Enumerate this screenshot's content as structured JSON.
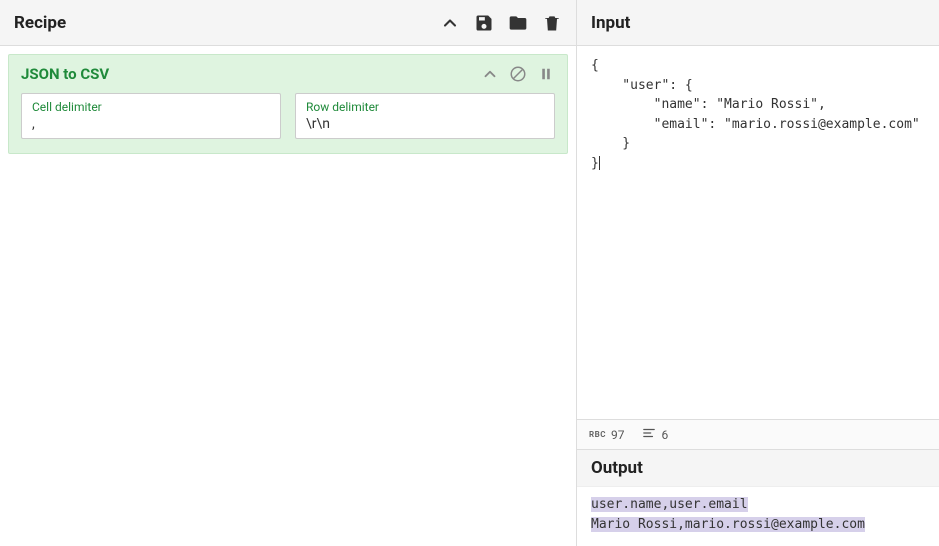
{
  "recipe": {
    "title": "Recipe",
    "operation": {
      "title": "JSON to CSV",
      "fields": {
        "cellDelimiter": {
          "label": "Cell delimiter",
          "value": ","
        },
        "rowDelimiter": {
          "label": "Row delimiter",
          "value": "\\r\\n"
        }
      }
    }
  },
  "input": {
    "title": "Input",
    "text": "{\n    \"user\": {\n        \"name\": \"Mario Rossi\",\n        \"email\": \"mario.rossi@example.com\"\n    }\n}"
  },
  "status": {
    "charsLabel": "RBC",
    "chars": "97",
    "lines": "6"
  },
  "output": {
    "title": "Output",
    "line1": "user.name,user.email",
    "line2": "Mario Rossi,mario.rossi@example.com"
  }
}
